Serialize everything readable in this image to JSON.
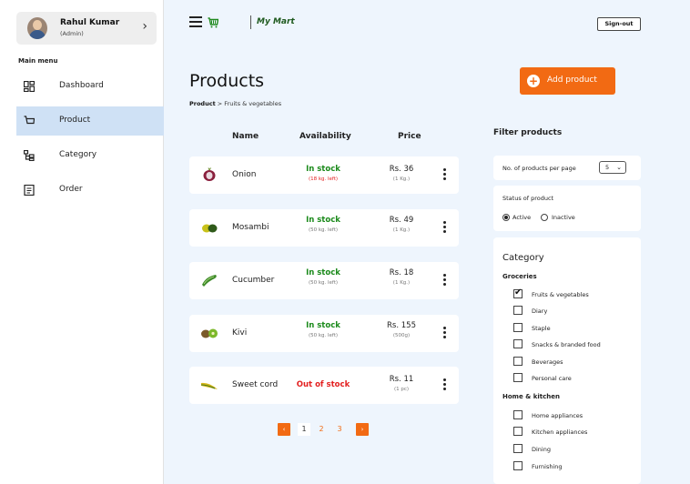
{
  "user": {
    "name": "Rahul Kumar",
    "role": "(Admin)"
  },
  "sidebar": {
    "menu_title": "Main menu",
    "items": [
      {
        "label": "Dashboard",
        "icon": "dashboard-icon"
      },
      {
        "label": "Product",
        "icon": "cart-icon",
        "active": true
      },
      {
        "label": "Category",
        "icon": "category-tree-icon"
      },
      {
        "label": "Order",
        "icon": "order-document-icon"
      }
    ]
  },
  "header": {
    "brand": "My Mart",
    "signout_label": "Sign-out"
  },
  "page": {
    "title": "Products",
    "breadcrumb_root": "Product",
    "breadcrumb_sep": ">",
    "breadcrumb_current": "Fruits & vegetables",
    "add_button_label": "Add product"
  },
  "table": {
    "columns": [
      "Name",
      "Availability",
      "Price"
    ],
    "rows": [
      {
        "name": "Onion",
        "status": "In stock",
        "left": "(18 kg. left)",
        "price": "Rs. 36",
        "unit": "(1 Kg.)",
        "in_stock": true
      },
      {
        "name": "Mosambi",
        "status": "In stock",
        "left": "(50 kg. left)",
        "price": "Rs. 49",
        "unit": "(1 Kg.)",
        "in_stock": true
      },
      {
        "name": "Cucumber",
        "status": "In stock",
        "left": "(50 kg. left)",
        "price": "Rs. 18",
        "unit": "(1 Kg.)",
        "in_stock": true
      },
      {
        "name": "Kivi",
        "status": "In stock",
        "left": "(50 kg. left)",
        "price": "Rs. 155",
        "unit": "(500g)",
        "in_stock": true
      },
      {
        "name": "Sweet cord",
        "status": "Out of stock",
        "left": "",
        "price": "Rs. 11",
        "unit": "(1 pc)",
        "in_stock": false
      }
    ]
  },
  "pagination": {
    "prev": "‹",
    "next": "›",
    "pages": [
      "1",
      "2",
      "3"
    ],
    "current": "1"
  },
  "filters": {
    "title": "Filter products",
    "per_page_label": "No. of products per page",
    "per_page_value": "5",
    "status_label": "Status of product",
    "status_options": [
      "Active",
      "Inactive"
    ],
    "status_selected": "Active",
    "category_title": "Category",
    "groups": [
      {
        "name": "Groceries",
        "items": [
          {
            "label": "Fruits & vegetables",
            "checked": true
          },
          {
            "label": "Diary",
            "checked": false
          },
          {
            "label": "Staple",
            "checked": false
          },
          {
            "label": "Snacks & branded food",
            "checked": false
          },
          {
            "label": "Beverages",
            "checked": false
          },
          {
            "label": "Personal care",
            "checked": false
          }
        ]
      },
      {
        "name": "Home & kitchen",
        "items": [
          {
            "label": "Home appliances",
            "checked": false
          },
          {
            "label": "Kitchen appliances",
            "checked": false
          },
          {
            "label": "Dining",
            "checked": false
          },
          {
            "label": "Furnishing",
            "checked": false
          }
        ]
      }
    ]
  },
  "colors": {
    "accent": "#f26a13",
    "in_stock": "#1b8a1b",
    "out_of_stock": "#e32020",
    "sidebar_active": "#cfe1f5",
    "main_bg": "#eef5fd"
  }
}
